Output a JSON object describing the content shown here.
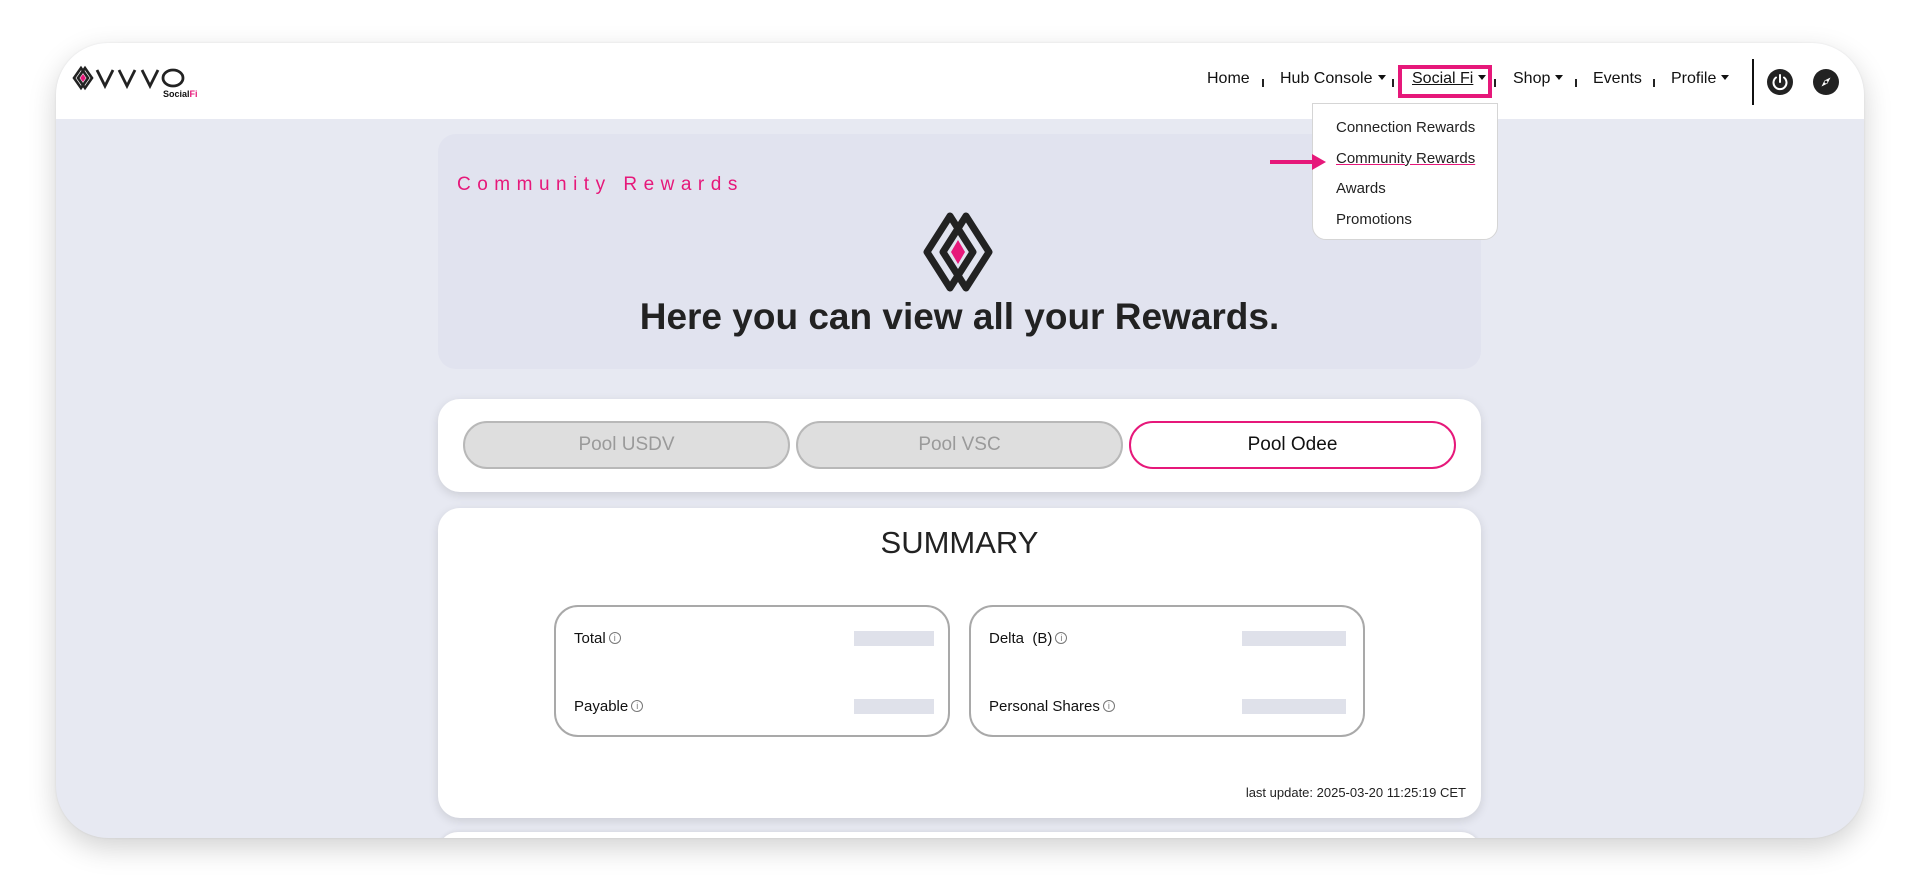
{
  "header": {
    "logo_text": "VYVO",
    "logo_sub_a": "Social",
    "logo_sub_b": "Fi",
    "nav": {
      "home": "Home",
      "hub_console": "Hub Console",
      "social_fi": "Social Fi",
      "shop": "Shop",
      "events": "Events",
      "profile": "Profile"
    }
  },
  "dropdown": {
    "items": [
      "Connection Rewards",
      "Community Rewards",
      "Awards",
      "Promotions"
    ]
  },
  "hero": {
    "title": "Community Rewards",
    "heading": "Here you can view all your Rewards."
  },
  "tabs": [
    "Pool USDV",
    "Pool VSC",
    "Pool Odee"
  ],
  "summary": {
    "title": "SUMMARY",
    "labels": {
      "total": "Total",
      "payable": "Payable",
      "delta": "Delta  (B)",
      "personal_shares": "Personal Shares"
    },
    "info_glyph": "i",
    "last_update": "last update: 2025-03-20 11:25:19 CET"
  },
  "colors": {
    "accent": "#e6187a",
    "background": "#e7e9f2"
  }
}
